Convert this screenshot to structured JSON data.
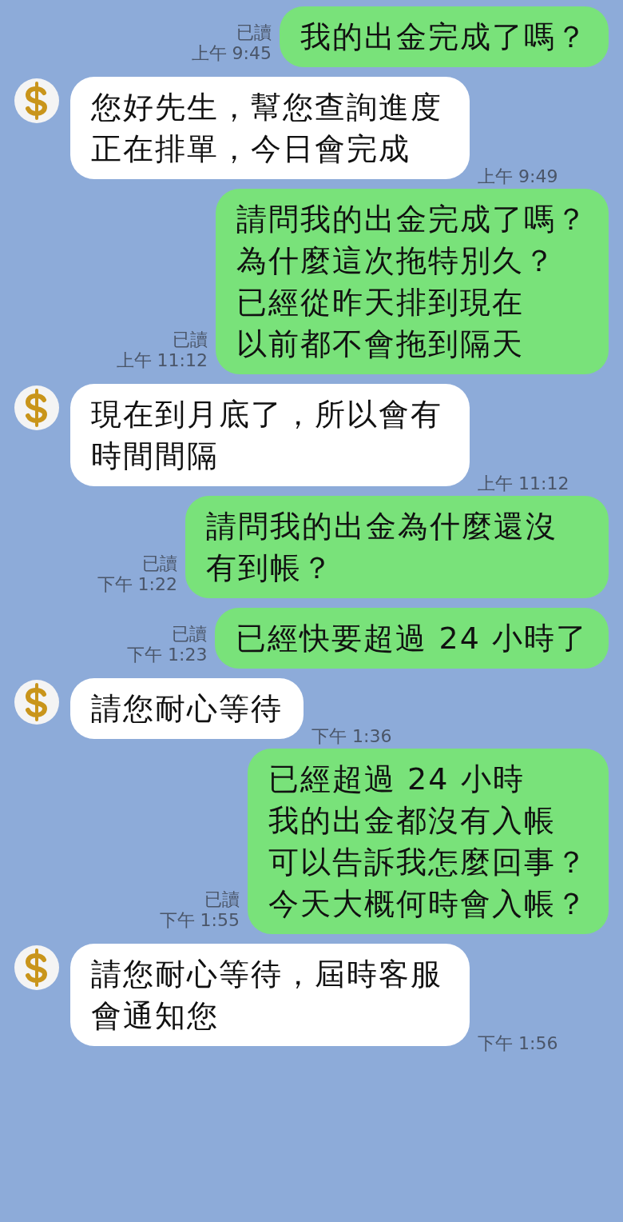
{
  "messages": [
    {
      "kind": "outgoing",
      "lines": [
        "我的出金完成了嗎？"
      ],
      "read_status": "已讀",
      "time": "上午 9:45"
    },
    {
      "kind": "incoming",
      "lines": [
        "您好先生，幫您查詢進度正在排單，今日會完成"
      ],
      "time": "上午 9:49"
    },
    {
      "kind": "outgoing",
      "lines": [
        "請問我的出金完成了嗎？",
        "為什麼這次拖特別久？",
        "已經從昨天排到現在",
        "以前都不會拖到隔天"
      ],
      "read_status": "已讀",
      "time": "上午 11:12"
    },
    {
      "kind": "incoming",
      "lines": [
        "現在到月底了，所以會有時間間隔"
      ],
      "time": "上午 11:12"
    },
    {
      "kind": "outgoing",
      "lines": [
        "請問我的出金為什麼還沒有到帳？"
      ],
      "read_status": "已讀",
      "time": "下午 1:22"
    },
    {
      "kind": "outgoing",
      "lines": [
        "已經快要超過 24 小時了"
      ],
      "read_status": "已讀",
      "time": "下午 1:23"
    },
    {
      "kind": "incoming",
      "lines": [
        "請您耐心等待"
      ],
      "time": "下午 1:36"
    },
    {
      "kind": "outgoing",
      "lines": [
        "已經超過 24 小時",
        "我的出金都沒有入帳",
        "可以告訴我怎麼回事？",
        "今天大概何時會入帳？"
      ],
      "read_status": "已讀",
      "time": "下午 1:55"
    },
    {
      "kind": "incoming",
      "lines": [
        "請您耐心等待，屆時客服會通知您"
      ],
      "time": "下午 1:56"
    }
  ]
}
